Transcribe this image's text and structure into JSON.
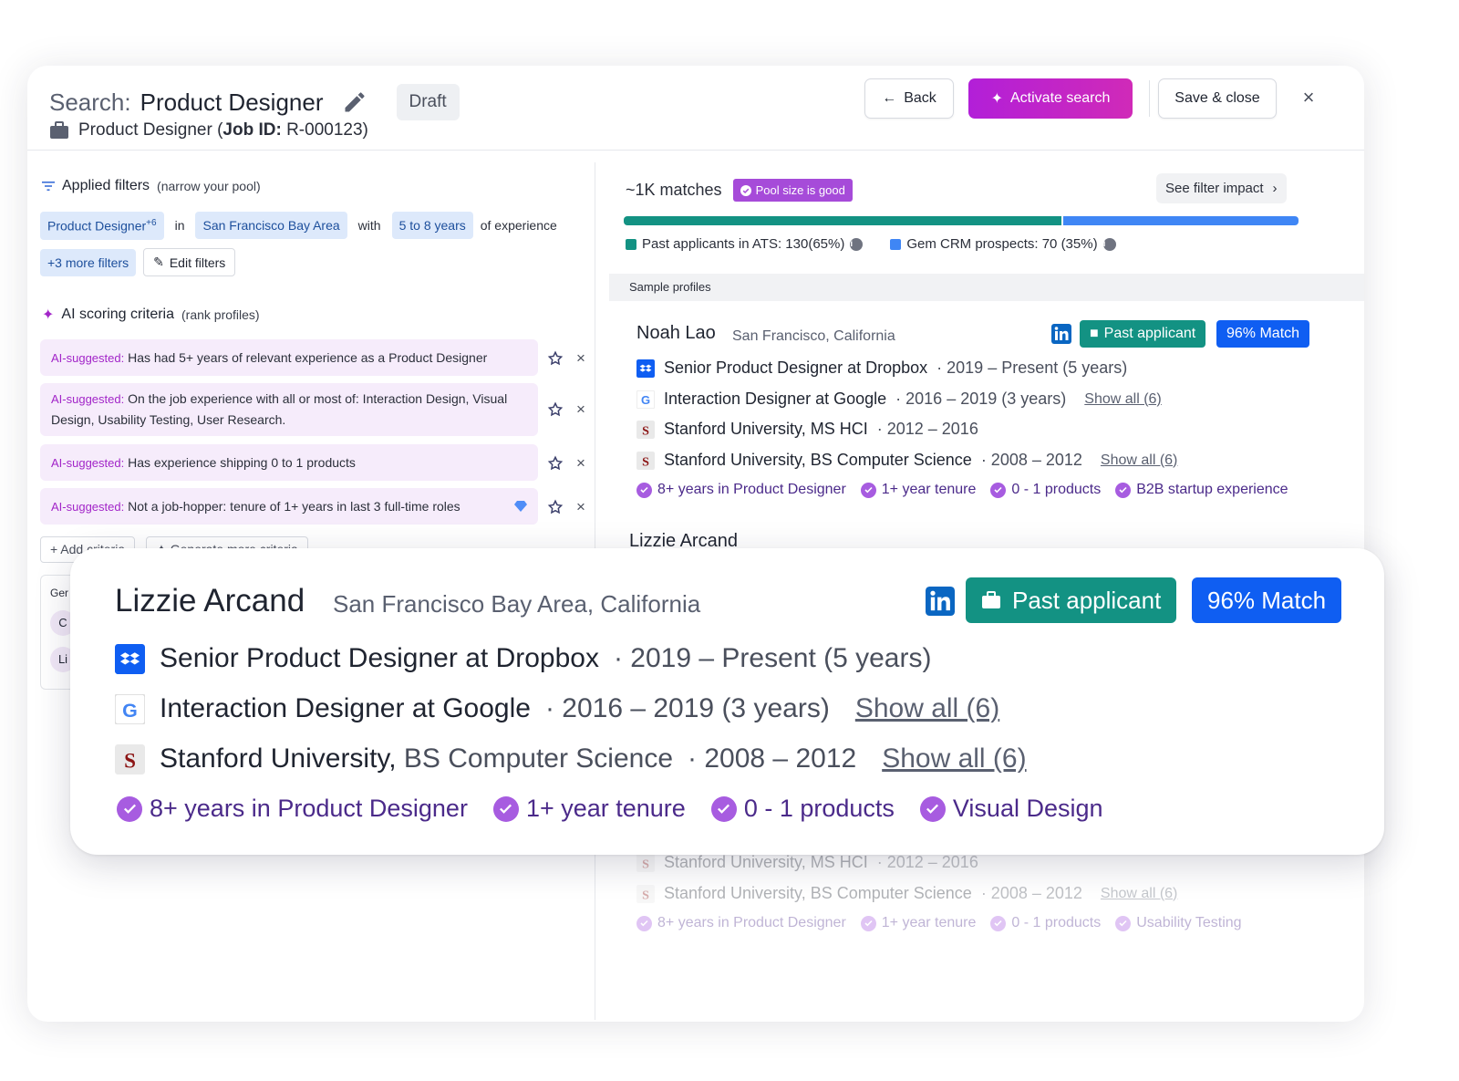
{
  "header": {
    "title_label": "Search:",
    "title_value": "Product Designer",
    "status": "Draft",
    "job_prefix": "Product Designer (",
    "job_id_label": "Job ID:",
    "job_id_value": " R-000123)",
    "back": "Back",
    "activate": "Activate search",
    "save_close": "Save & close",
    "close": "×"
  },
  "filters": {
    "heading": "Applied filters",
    "heading_note": "(narrow your pool)",
    "role_chip": "Product Designer",
    "role_extra": "+6",
    "in": "in",
    "location_chip": "San Francisco Bay Area",
    "with": "with",
    "experience_chip": "5 to 8 years",
    "of_experience": "of experience",
    "more_filters": "+3 more filters",
    "edit_filters": "Edit filters"
  },
  "criteria": {
    "heading": "AI scoring criteria",
    "heading_note": "(rank profiles)",
    "prefix": "AI-suggested:",
    "items": [
      "Has had 5+ years of relevant experience as a Product Designer",
      "On the job experience with all or most of: Interaction Design, Visual Design, Usability Testing, User Research.",
      "Has experience shipping 0 to 1 products",
      "Not a job-hopper: tenure of 1+ years in last 3 full-time roles"
    ],
    "add": "+ Add criteria",
    "generate": "✦ Generate more criteria",
    "gen_box_label": "Ger",
    "gen_chip1": "C",
    "gen_chip2": "Li"
  },
  "pool": {
    "matches": "~1K matches",
    "badge": "Pool size is good",
    "see_impact": "See filter impact",
    "ats_pct": 65,
    "crm_pct": 35,
    "legend_ats": "Past applicants in ATS: 130(65%)",
    "legend_crm": "Gem CRM prospects: 70 (35%)",
    "colors": {
      "ats": "#139283",
      "crm": "#3f86f5"
    }
  },
  "sample_heading": "Sample profiles",
  "profile1": {
    "name": "Noah Lao",
    "location": "San Francisco, California",
    "badge_source": "Past applicant",
    "badge_match": "96% Match",
    "exp1_role": "Senior Product Designer at Dropbox",
    "exp1_dates": "· 2019 – Present (5 years)",
    "exp2_role": "Interaction Designer at Google",
    "exp2_dates": "· 2016 – 2019 (3 years)",
    "show_all": "Show all (6)",
    "edu1_school": "Stanford University, MS HCI",
    "edu1_dates": "· 2012 – 2016",
    "edu2_school": "Stanford University, BS Computer Science",
    "edu2_dates": "· 2008 – 2012",
    "tags": [
      "8+ years in Product Designer",
      "1+ year tenure",
      "0 - 1 products",
      "B2B startup experience"
    ]
  },
  "profile2_faded": {
    "name_cut": "Lizzie Arcand",
    "edu1_school": "Stanford University, MS HCI",
    "edu1_dates": "· 2012 – 2016",
    "edu2_school": "Stanford University, BS Computer Science",
    "edu2_dates": "· 2008 – 2012",
    "show_all": "Show all (6)",
    "tags": [
      "8+ years in Product Designer",
      "1+ year tenure",
      "0 - 1 products",
      "Usability Testing"
    ]
  },
  "card": {
    "name": "Lizzie Arcand",
    "location": "San Francisco Bay Area, California",
    "badge_source": "Past applicant",
    "badge_match": "96% Match",
    "exp1_a": "Senior Product Designer",
    "exp1_at": "at",
    "exp1_company": "Dropbox",
    "exp1_dates": "· 2019 – Present (5 years)",
    "exp2_a": "Interaction Designer",
    "exp2_at": "at",
    "exp2_company": "Google",
    "exp2_dates": "· 2016 – 2019 (3 years)",
    "edu_school": "Stanford University,",
    "edu_degree": "BS Computer Science",
    "edu_dates": "· 2008 – 2012",
    "show_all": "Show all (6)",
    "tags": [
      "8+ years in Product Designer",
      "1+ year tenure",
      "0 - 1 products",
      "Visual Design"
    ]
  }
}
